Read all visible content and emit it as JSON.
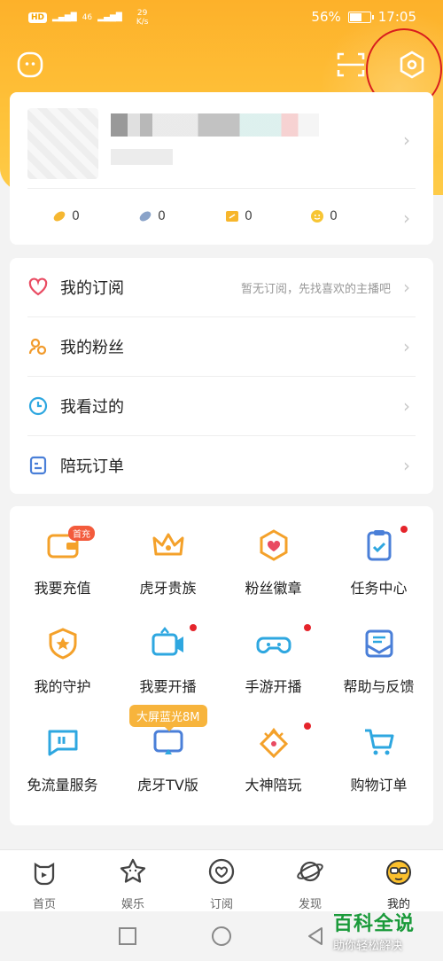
{
  "status_bar": {
    "hd": "HD",
    "signal": "46",
    "speed_value": "29",
    "speed_unit": "K/s",
    "battery": "56%",
    "time": "17:05"
  },
  "profile": {
    "wallet": [
      {
        "name": "gold-bean",
        "value": "0",
        "color": "#f5b731"
      },
      {
        "name": "silver-bean",
        "value": "0",
        "color": "#8aa3c9"
      },
      {
        "name": "coupon",
        "value": "0",
        "color": "#f7b62c"
      },
      {
        "name": "coin",
        "value": "0",
        "color": "#f7c534"
      }
    ]
  },
  "list": [
    {
      "label": "我的订阅",
      "hint": "暂无订阅，先找喜欢的主播吧",
      "icon": "heart-icon",
      "color": "#e94b62"
    },
    {
      "label": "我的粉丝",
      "hint": "",
      "icon": "fans-icon",
      "color": "#f19a2b"
    },
    {
      "label": "我看过的",
      "hint": "",
      "icon": "clock-icon",
      "color": "#2ea7e0"
    },
    {
      "label": "陪玩订单",
      "hint": "",
      "icon": "order-icon",
      "color": "#4a7fd8"
    }
  ],
  "grid": [
    {
      "label": "我要充值",
      "icon": "wallet-icon",
      "badge": "首充"
    },
    {
      "label": "虎牙贵族",
      "icon": "crown-icon"
    },
    {
      "label": "粉丝徽章",
      "icon": "badge-heart-icon"
    },
    {
      "label": "任务中心",
      "icon": "clipboard-icon",
      "dot": true
    },
    {
      "label": "我的守护",
      "icon": "shield-icon"
    },
    {
      "label": "我要开播",
      "icon": "camera-icon",
      "dot": true
    },
    {
      "label": "手游开播",
      "icon": "gamepad-icon",
      "dot": true
    },
    {
      "label": "帮助与反馈",
      "icon": "mail-icon"
    },
    {
      "label": "免流量服务",
      "icon": "data-card-icon"
    },
    {
      "label": "虎牙TV版",
      "icon": "tv-icon",
      "tag": "大屏蓝光8M"
    },
    {
      "label": "大神陪玩",
      "icon": "master-icon",
      "dot": true
    },
    {
      "label": "购物订单",
      "icon": "cart-icon"
    }
  ],
  "bottom_nav": [
    {
      "label": "首页",
      "icon": "home-icon"
    },
    {
      "label": "娱乐",
      "icon": "star-icon"
    },
    {
      "label": "订阅",
      "icon": "subscribe-heart-icon"
    },
    {
      "label": "发现",
      "icon": "planet-icon"
    },
    {
      "label": "我的",
      "icon": "me-icon",
      "active": true
    }
  ],
  "watermark": {
    "main": "百科全说",
    "sub": "助你轻松解决"
  },
  "colors": {
    "brand": "#fdb12a",
    "highlight_circle": "#d81e1e"
  }
}
